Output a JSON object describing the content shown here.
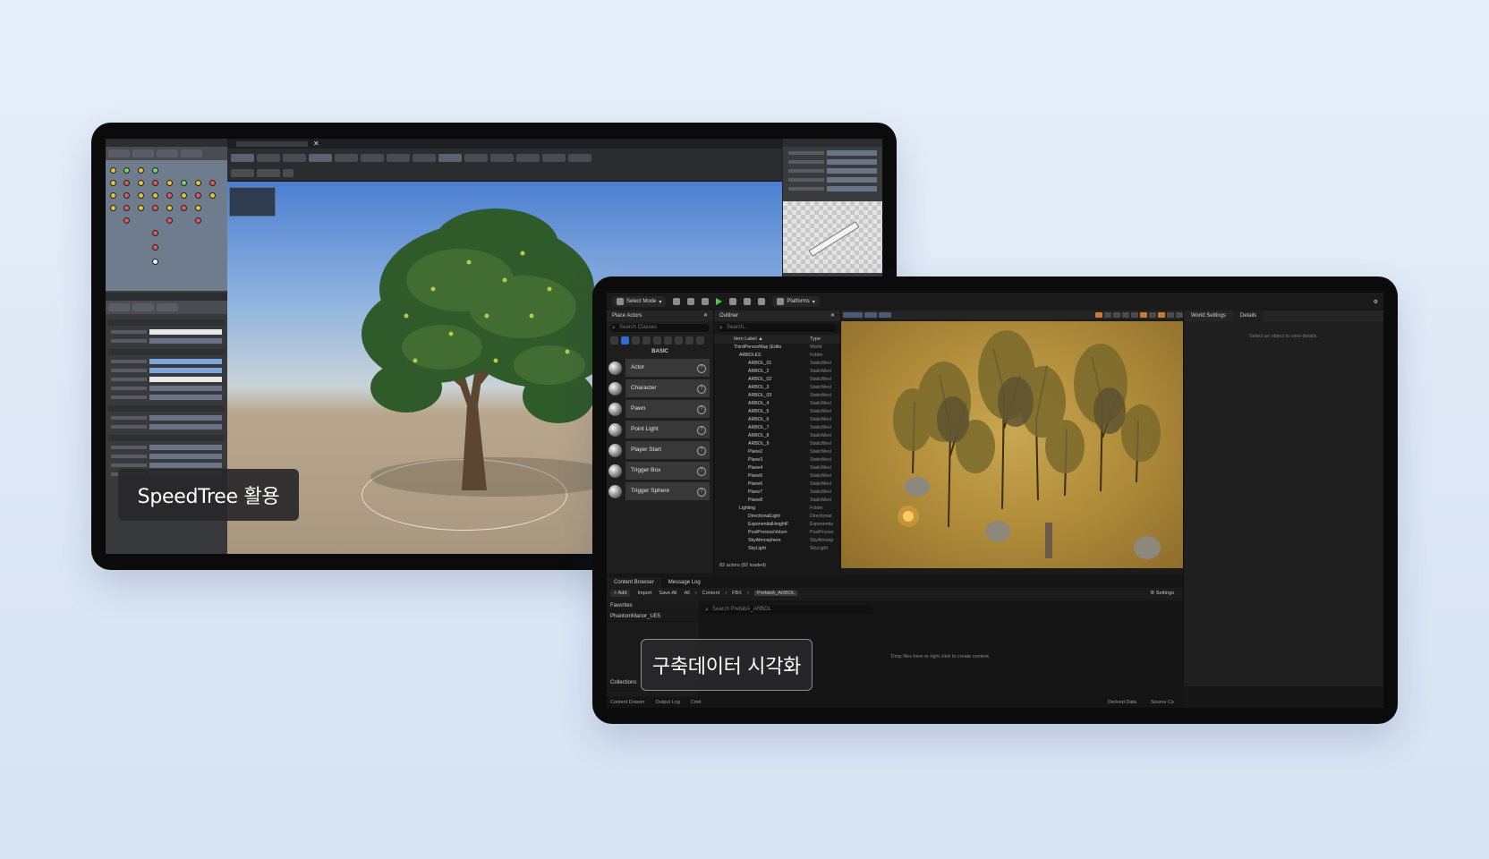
{
  "captions": {
    "speedtree": "SpeedTree 활용",
    "unreal": "구축데이터 시각화"
  },
  "unreal": {
    "toolbar": {
      "select_mode": "Select Mode",
      "platforms": "Platforms"
    },
    "place_actors": {
      "title": "Place Actors",
      "search_placeholder": "Search Classes",
      "category": "BASIC",
      "items": [
        "Actor",
        "Character",
        "Pawn",
        "Point Light",
        "Player Start",
        "Trigger Box",
        "Trigger Sphere"
      ]
    },
    "outliner": {
      "title": "Outliner",
      "search_placeholder": "Search...",
      "col_label": "Item Label ▲",
      "col_type": "Type",
      "rows": [
        {
          "name": "ThirdPersonMap (Edito",
          "type": "World"
        },
        {
          "name": "ARBOLES",
          "type": "Folder"
        },
        {
          "name": "ARBOL_01",
          "type": "StaticMesl"
        },
        {
          "name": "ARBOL_2",
          "type": "StaticMesl"
        },
        {
          "name": "ARBOL_02",
          "type": "StaticMesl"
        },
        {
          "name": "ARBOL_3",
          "type": "StaticMesl"
        },
        {
          "name": "ARBOL_03",
          "type": "StaticMesl"
        },
        {
          "name": "ARBOL_4",
          "type": "StaticMesl"
        },
        {
          "name": "ARBOL_5",
          "type": "StaticMesl"
        },
        {
          "name": "ARBOL_6",
          "type": "StaticMesl"
        },
        {
          "name": "ARBOL_7",
          "type": "StaticMesl"
        },
        {
          "name": "ARBOL_8",
          "type": "StaticMesl"
        },
        {
          "name": "ARBOL_9",
          "type": "StaticMesl"
        },
        {
          "name": "Plane2",
          "type": "StaticMesl"
        },
        {
          "name": "Plane3",
          "type": "StaticMesl"
        },
        {
          "name": "Plane4",
          "type": "StaticMesl"
        },
        {
          "name": "Plane5",
          "type": "StaticMesl"
        },
        {
          "name": "Plane6",
          "type": "StaticMesl"
        },
        {
          "name": "Plane7",
          "type": "StaticMesl"
        },
        {
          "name": "Plane8",
          "type": "StaticMesl"
        },
        {
          "name": "Lighting",
          "type": "Folder"
        },
        {
          "name": "DirectionalLight",
          "type": "Directional"
        },
        {
          "name": "ExponentialHeightF",
          "type": "Exponentia"
        },
        {
          "name": "PostProcessVolum",
          "type": "PostProces"
        },
        {
          "name": "SkyAtmosphere",
          "type": "SkyAtmosp"
        },
        {
          "name": "SkyLight",
          "type": "SkyLight"
        }
      ],
      "footer": "82 actors (82 loaded)"
    },
    "viewport": {
      "mode": "Perspective",
      "lit": "Lit",
      "show": "Show"
    },
    "details": {
      "tab_world": "World Settings",
      "tab_details": "Details",
      "empty": "Select an object to view details."
    },
    "content_browser": {
      "tab": "Content Browser",
      "tab_log": "Message Log",
      "add": "Add",
      "import": "Import",
      "save_all": "Save All",
      "crumbs": [
        "All",
        "Content",
        "FBX",
        "PrefabA_ARBOL"
      ],
      "settings": "Settings",
      "side": [
        "Favorites",
        "PhantomManor_UE5",
        "Collections"
      ],
      "search_placeholder": "Search PrefabA_ARBOL",
      "drop_hint": "Drop files here or right click to create content.",
      "status": [
        "Content Drawer",
        "Output Log",
        "Cmd"
      ],
      "status_right": [
        "Derived Data",
        "Source Co"
      ]
    }
  }
}
